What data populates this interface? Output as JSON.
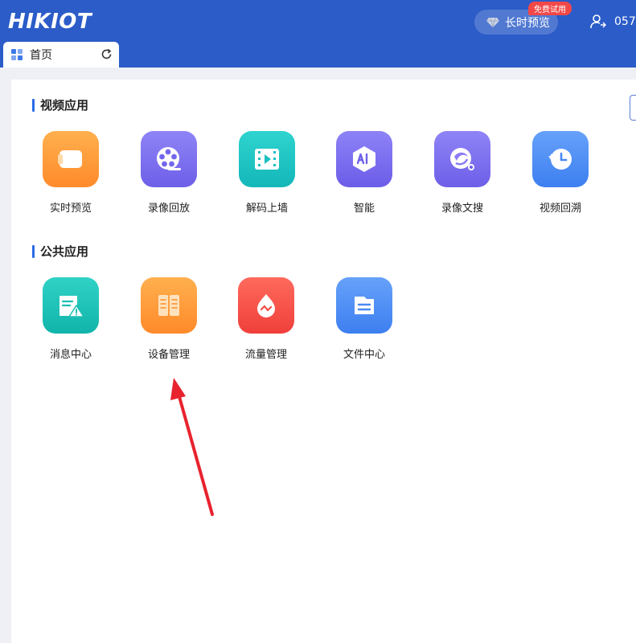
{
  "header": {
    "logo": "HIKIOT",
    "trial_label": "长时预览",
    "trial_badge": "免费试用",
    "user_text": "057"
  },
  "tab": {
    "label": "首页"
  },
  "sections": [
    {
      "title": "视频应用",
      "apps": [
        {
          "label": "实时预览",
          "icon": "camera-icon",
          "color": "#ff9a3c"
        },
        {
          "label": "录像回放",
          "icon": "film-reel-icon",
          "color": "#7a6cf0"
        },
        {
          "label": "解码上墙",
          "icon": "video-wall-icon",
          "color": "#1fc4c4"
        },
        {
          "label": "智能",
          "icon": "ai-icon",
          "color": "#7b6ef2"
        },
        {
          "label": "录像文搜",
          "icon": "search-record-icon",
          "color": "#7a6cf0"
        },
        {
          "label": "视频回溯",
          "icon": "history-icon",
          "color": "#4f8ff7"
        }
      ]
    },
    {
      "title": "公共应用",
      "apps": [
        {
          "label": "消息中心",
          "icon": "message-alert-icon",
          "color": "#1fc2b8"
        },
        {
          "label": "设备管理",
          "icon": "device-icon",
          "color": "#ff9a3c"
        },
        {
          "label": "流量管理",
          "icon": "traffic-icon",
          "color": "#f6504b"
        },
        {
          "label": "文件中心",
          "icon": "folder-icon",
          "color": "#4f8ff7"
        }
      ]
    }
  ],
  "annotation_color": "#e8232e"
}
